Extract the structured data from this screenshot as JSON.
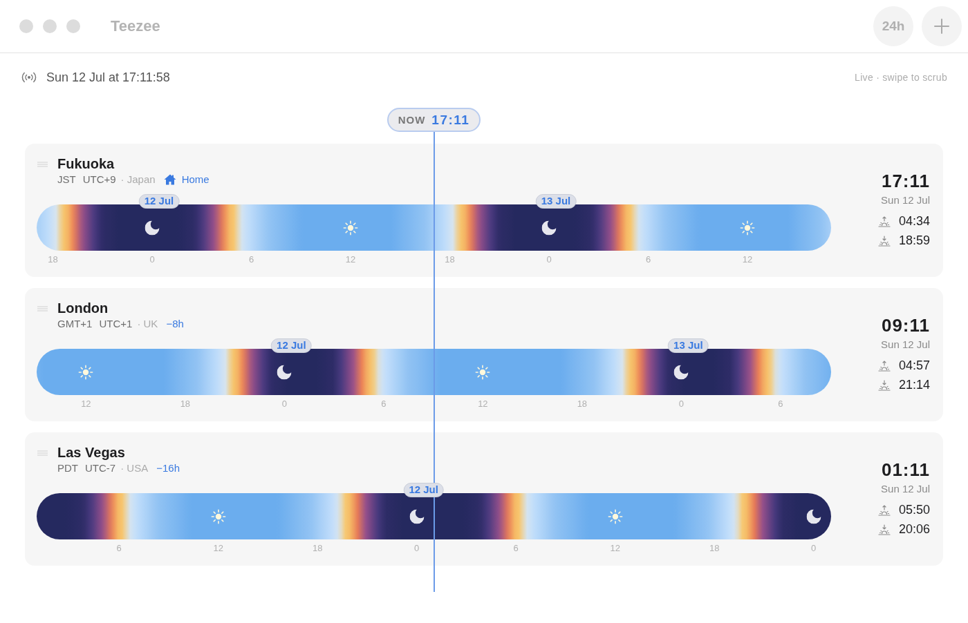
{
  "window": {
    "title": "Teezee",
    "buttons": [
      {
        "kind": "text",
        "label": "24h"
      },
      {
        "kind": "add"
      }
    ]
  },
  "status": {
    "datetime": "Sun 12 Jul at 17:11:58",
    "hint": "Live · swipe to scrub"
  },
  "now": {
    "label": "NOW",
    "time": "17:11"
  },
  "cities": [
    {
      "name": "Fukuoka",
      "abbreviation": "JST",
      "utc_offset": "UTC+9",
      "country": "· Japan",
      "relation": {
        "kind": "home",
        "label": "Home"
      },
      "time": "17:11",
      "date": "Sun 12 Jul",
      "sunrise": "04:34",
      "sunset": "18:59",
      "ticks": [
        "18",
        "0",
        "6",
        "12",
        "18",
        "0",
        "6",
        "12"
      ],
      "dates": [
        "12 Jul",
        "13 Jul"
      ]
    },
    {
      "name": "London",
      "abbreviation": "GMT+1",
      "utc_offset": "UTC+1",
      "country": "· UK",
      "relation": {
        "kind": "offset",
        "label": "−8h"
      },
      "time": "09:11",
      "date": "Sun 12 Jul",
      "sunrise": "04:57",
      "sunset": "21:14",
      "ticks": [
        "12",
        "18",
        "0",
        "6",
        "12",
        "18",
        "0",
        "6"
      ],
      "dates": [
        "12 Jul",
        "13 Jul"
      ]
    },
    {
      "name": "Las Vegas",
      "abbreviation": "PDT",
      "utc_offset": "UTC-7",
      "country": "· USA",
      "relation": {
        "kind": "offset",
        "label": "−16h"
      },
      "time": "01:11",
      "date": "Sun 12 Jul",
      "sunrise": "05:50",
      "sunset": "20:06",
      "ticks": [
        "6",
        "12",
        "18",
        "0",
        "6",
        "12",
        "18",
        "0"
      ],
      "dates": [
        "12 Jul"
      ]
    }
  ]
}
